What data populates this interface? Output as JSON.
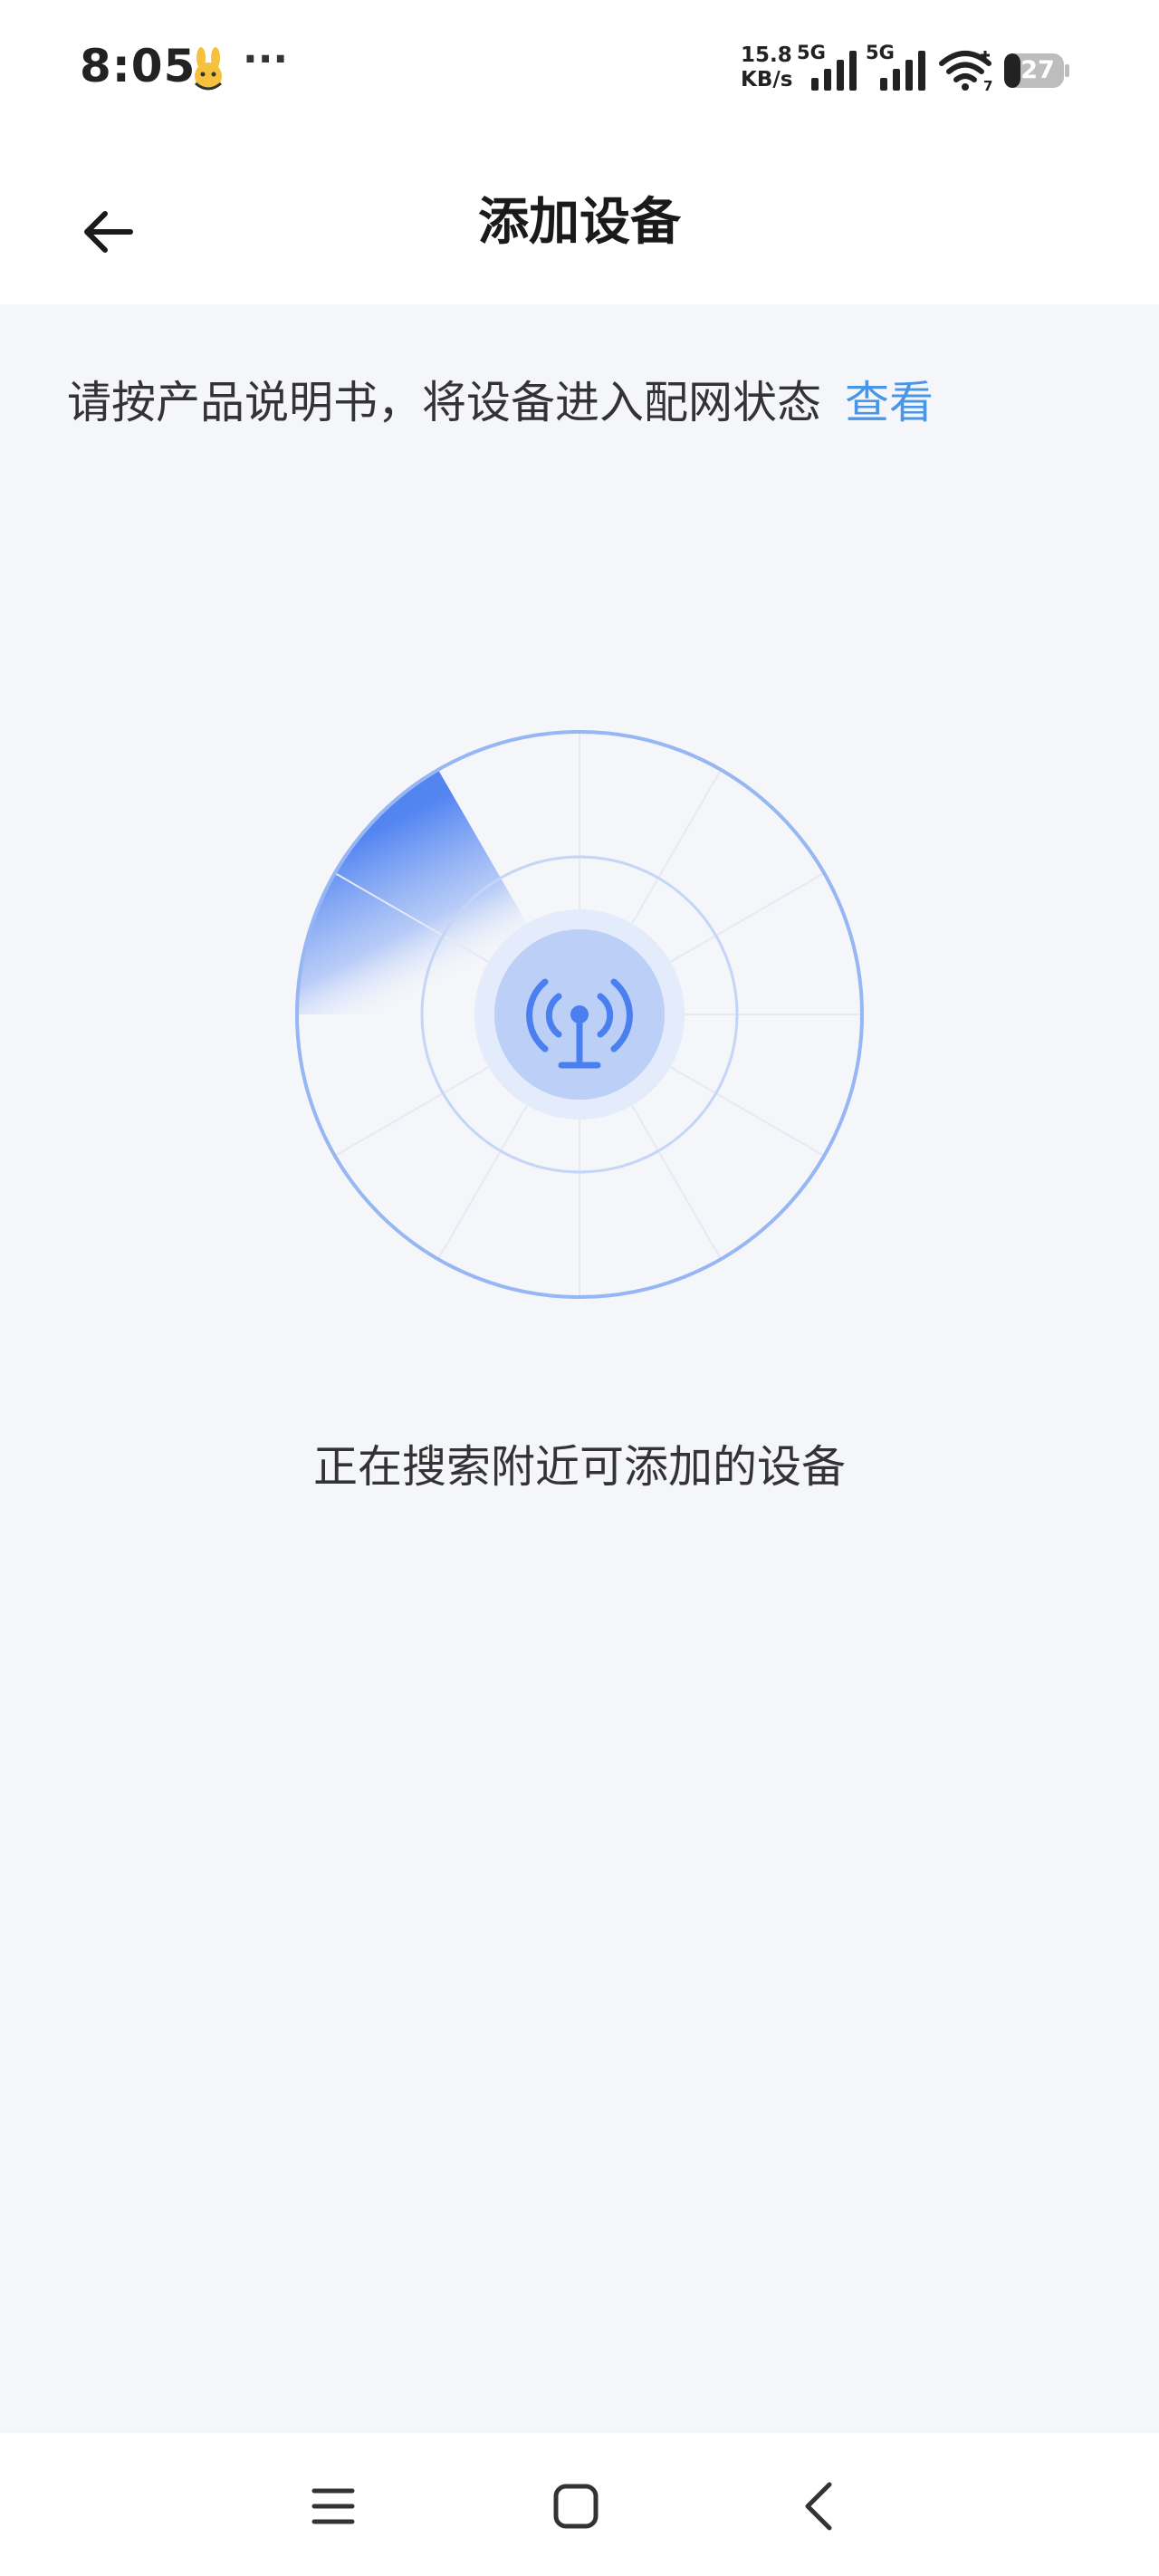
{
  "status_bar": {
    "time": "8:05",
    "more": "···",
    "net_speed_value": "15.8",
    "net_speed_unit": "KB/s",
    "sim1_label": "5G",
    "sim2_label": "5G",
    "wifi_badge": "7",
    "battery_level": "27"
  },
  "header": {
    "title": "添加设备",
    "back_icon": "arrow-left-icon"
  },
  "instruction": {
    "text": "请按产品说明书，将设备进入配网状态",
    "link_label": "查看"
  },
  "radar": {
    "center_icon": "broadcast-tower-icon",
    "accent": "#4a7ff0"
  },
  "status_message": "正在搜索附近可添加的设备",
  "nav_bar": {
    "menu_icon": "menu-icon",
    "home_icon": "home-square-icon",
    "back_icon": "chevron-left-icon"
  },
  "colors": {
    "accent": "#4a96e6",
    "background": "#f5f6fa"
  }
}
